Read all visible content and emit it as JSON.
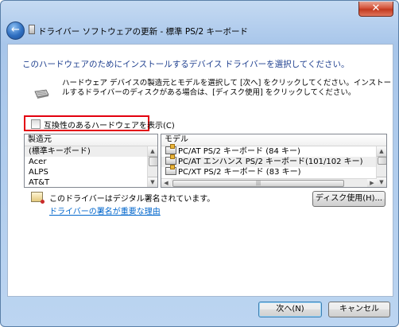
{
  "window": {
    "title": "ドライバー ソフトウェアの更新 - 標準 PS/2 キーボード",
    "close_label": "✕",
    "back_icon": "back-arrow-icon"
  },
  "main": {
    "heading": "このハードウェアのためにインストールするデバイス ドライバーを選択してください。",
    "description": "ハードウェア デバイスの製造元とモデルを選択して [次へ] をクリックしてください。インストールするドライバーのディスクがある場合は、[ディスク使用] をクリックしてください。",
    "compat_label": "互換性のあるハードウェアを表示(C)",
    "manufacturer_list": {
      "header": "製造元",
      "items": [
        "(標準キーボード)",
        "Acer",
        "ALPS",
        "AT&T"
      ]
    },
    "model_list": {
      "header": "モデル",
      "items": [
        "PC/AT PS/2 キーボード (84 キー)",
        "PC/AT エンハンス PS/2 キーボード(101/102 キー)",
        "PC/XT PS/2 キーボード (83 キー)"
      ]
    },
    "signed_text": "このドライバーはデジタル署名されています。",
    "signing_link": "ドライバーの署名が重要な理由",
    "disk_button": "ディスク使用(H)..."
  },
  "footer": {
    "next_button": "次へ(N)",
    "cancel_button": "キャンセル"
  },
  "colors": {
    "heading": "#1e3f8f",
    "link": "#0066cc",
    "highlight_border": "#e3000f",
    "frame": "#b5cfee"
  }
}
